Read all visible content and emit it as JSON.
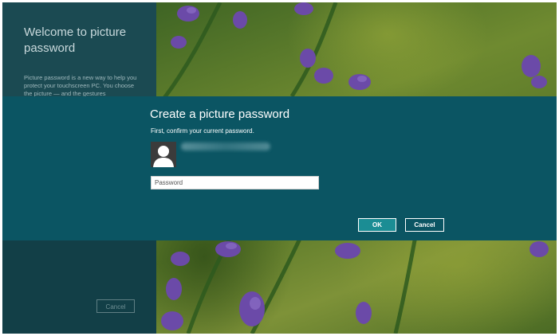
{
  "left_panel": {
    "title": "Welcome to picture password",
    "description": "Picture password is a new way to help you protect your touchscreen PC. You choose the picture — and the gestures",
    "cancel_label": "Cancel"
  },
  "dialog": {
    "title": "Create a picture password",
    "subtitle": "First, confirm your current password.",
    "password_placeholder": "Password",
    "password_value": "",
    "ok_label": "OK",
    "cancel_label": "Cancel"
  },
  "icons": {
    "avatar": "user-silhouette-icon"
  },
  "colors": {
    "dialog_band": "#0b5563",
    "left_panel": "#1b4a52",
    "ok_button": "#1b8d94",
    "flowers": "#6b4aa8"
  }
}
